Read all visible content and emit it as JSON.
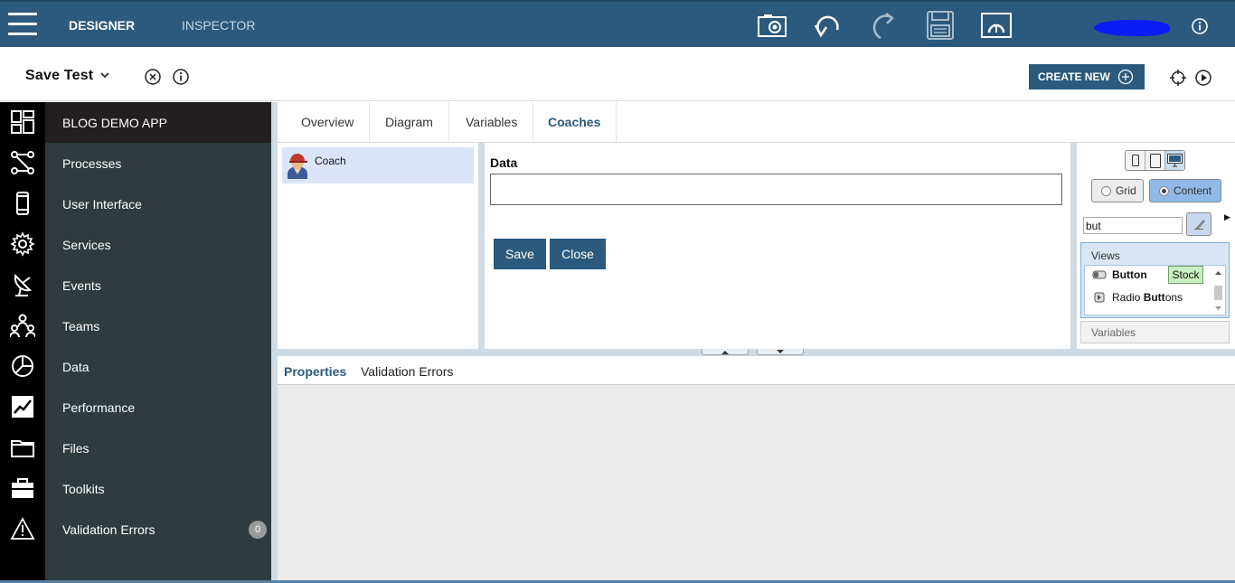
{
  "topbar": {
    "tabs": [
      {
        "label": "DESIGNER",
        "active": true
      },
      {
        "label": "INSPECTOR",
        "active": false
      }
    ],
    "tools": [
      "camera-icon",
      "undo-icon",
      "redo-icon",
      "save-icon",
      "speedometer-icon"
    ],
    "info_icon": "info-icon"
  },
  "header": {
    "title": "Save Test",
    "create_new_label": "CREATE NEW"
  },
  "rail_icons": [
    "dashboard-icon",
    "processes-icon",
    "mobile-icon",
    "gear-icon",
    "satellite-dish-icon",
    "team-icon",
    "pie-chart-icon",
    "line-chart-icon",
    "folder-icon",
    "toolbox-icon",
    "warning-icon"
  ],
  "nav": {
    "heading": "BLOG DEMO APP",
    "items": [
      {
        "label": "Processes"
      },
      {
        "label": "User Interface"
      },
      {
        "label": "Services"
      },
      {
        "label": "Events"
      },
      {
        "label": "Teams"
      },
      {
        "label": "Data"
      },
      {
        "label": "Performance"
      },
      {
        "label": "Files"
      },
      {
        "label": "Toolkits"
      },
      {
        "label": "Validation Errors",
        "badge": "0"
      }
    ]
  },
  "main": {
    "tabs": [
      {
        "label": "Overview",
        "active": false
      },
      {
        "label": "Diagram",
        "active": false
      },
      {
        "label": "Variables",
        "active": false
      },
      {
        "label": "Coaches",
        "active": true
      }
    ],
    "coach_list": [
      {
        "label": "Coach"
      }
    ],
    "canvas": {
      "field_label": "Data",
      "field_value": "",
      "buttons": [
        "Save",
        "Close"
      ]
    },
    "palette": {
      "grid_label": "Grid",
      "content_label": "Content",
      "selected_mode": "Content",
      "search_value": "but",
      "views_label": "Views",
      "views": [
        {
          "pre": "",
          "match": "Button",
          "post": "",
          "tag": "Stock"
        },
        {
          "pre": "Radio ",
          "match": "Butt",
          "post": "ons",
          "tag": ""
        }
      ],
      "variables_label": "Variables"
    }
  },
  "bottom": {
    "tabs": [
      {
        "label": "Properties",
        "active": true
      },
      {
        "label": "Validation Errors",
        "active": false
      }
    ]
  },
  "colors": {
    "brand": "#2b5a7e",
    "nav_bg": "#2f3b3e",
    "nav_head_bg": "#231f20",
    "selection": "#dbe5fa"
  }
}
